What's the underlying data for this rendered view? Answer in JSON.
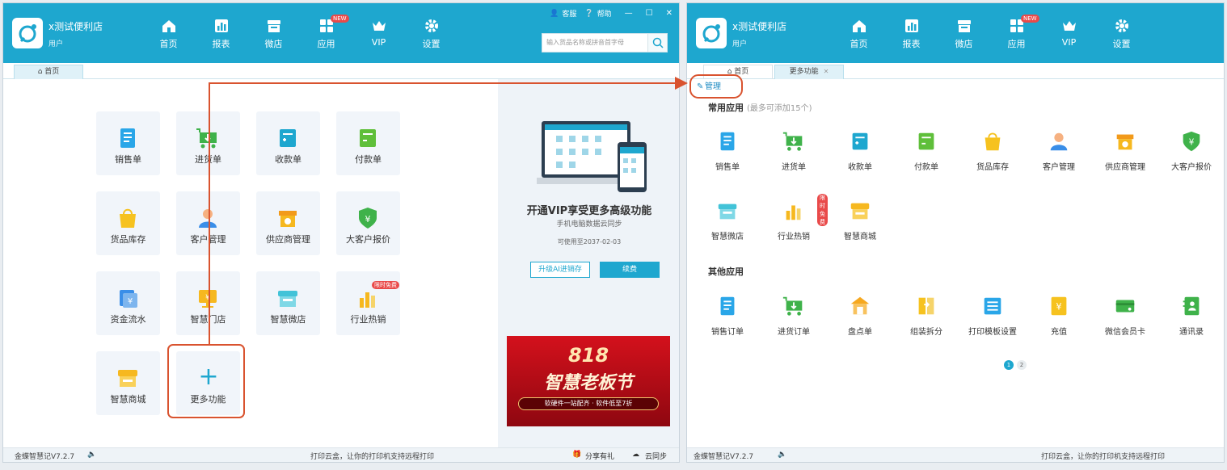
{
  "app": {
    "store_name": "x测试便利店",
    "user_role": "用户",
    "nav": [
      {
        "label": "首页",
        "icon": "home-icon"
      },
      {
        "label": "报表",
        "icon": "report-icon"
      },
      {
        "label": "微店",
        "icon": "shop-icon"
      },
      {
        "label": "应用",
        "icon": "apps-icon",
        "badge": "NEW"
      },
      {
        "label": "VIP",
        "icon": "vip-crown-icon"
      },
      {
        "label": "设置",
        "icon": "gear-icon"
      }
    ],
    "service_label": "客服",
    "help_label": "帮助",
    "search_placeholder": "输入货品名称或拼音首字母",
    "version": "金蝶智慧记V7.2.7",
    "print_promo": "打印云盒，让你的打印机支持远程打印",
    "share_label": "分享有礼",
    "sync_label": "云同步"
  },
  "left": {
    "tab_home": "首页",
    "tiles": [
      {
        "label": "销售单",
        "icon": "sales-order-icon",
        "color": "#2aa6e8"
      },
      {
        "label": "进货单",
        "icon": "purchase-cart-icon",
        "color": "#3fb24a"
      },
      {
        "label": "收款单",
        "icon": "receipt-icon",
        "color": "#1ea7cf"
      },
      {
        "label": "付款单",
        "icon": "payment-icon",
        "color": "#5fbf3a"
      },
      {
        "label": "货品库存",
        "icon": "inventory-bag-icon",
        "color": "#f6c21f"
      },
      {
        "label": "客户管理",
        "icon": "customer-icon",
        "color": "#3a8ee8"
      },
      {
        "label": "供应商管理",
        "icon": "supplier-icon",
        "color": "#f6b81f"
      },
      {
        "label": "大客户报价",
        "icon": "vip-quote-shield-icon",
        "color": "#3fb24a"
      },
      {
        "label": "资金流水",
        "icon": "cash-flow-icon",
        "color": "#3a8ee8"
      },
      {
        "label": "智慧门店",
        "icon": "smart-store-icon",
        "color": "#f6b81f"
      },
      {
        "label": "智慧微店",
        "icon": "smart-microshop-icon",
        "color": "#42c3d8"
      },
      {
        "label": "行业热销",
        "icon": "hot-sales-chart-icon",
        "color": "#f6b81f",
        "tag": "限时免费"
      },
      {
        "label": "智慧商城",
        "icon": "smart-mall-icon",
        "color": "#f6b81f"
      },
      {
        "label": "更多功能",
        "icon": "plus-icon",
        "color": "#1ea7cf"
      }
    ],
    "vip": {
      "title": "开通VIP享受更多高级功能",
      "subtitle": "手机电脑数据云同步",
      "valid_until": "可使用至2037-02-03",
      "upgrade_label": "升级AI进销存",
      "renew_label": "续费"
    },
    "banner": {
      "line1": "818",
      "line2": "智慧老板节",
      "line3": "软硬件一站配齐 · 软件低至7折"
    }
  },
  "right": {
    "tab_home": "首页",
    "tab_more": "更多功能",
    "manage_label": "管理",
    "common_title": "常用应用",
    "common_note": "(最多可添加15个)",
    "common_apps": [
      {
        "label": "销售单",
        "icon": "sales-order-icon",
        "color": "#2aa6e8"
      },
      {
        "label": "进货单",
        "icon": "purchase-cart-icon",
        "color": "#3fb24a"
      },
      {
        "label": "收款单",
        "icon": "receipt-icon",
        "color": "#1ea7cf"
      },
      {
        "label": "付款单",
        "icon": "payment-icon",
        "color": "#5fbf3a"
      },
      {
        "label": "货品库存",
        "icon": "inventory-bag-icon",
        "color": "#f6c21f"
      },
      {
        "label": "客户管理",
        "icon": "customer-icon",
        "color": "#3a8ee8"
      },
      {
        "label": "供应商管理",
        "icon": "supplier-icon",
        "color": "#f6b81f"
      },
      {
        "label": "大客户报价",
        "icon": "vip-quote-shield-icon",
        "color": "#3fb24a"
      },
      {
        "label": "智慧微店",
        "icon": "smart-microshop-icon",
        "color": "#42c3d8"
      },
      {
        "label": "行业热销",
        "icon": "hot-sales-chart-icon",
        "color": "#f6b81f",
        "tag": "限时免费"
      },
      {
        "label": "智慧商城",
        "icon": "smart-mall-icon",
        "color": "#f6b81f"
      }
    ],
    "other_title": "其他应用",
    "other_apps": [
      {
        "label": "销售订单",
        "icon": "sales-order-icon",
        "color": "#2aa6e8"
      },
      {
        "label": "进货订单",
        "icon": "purchase-cart-icon",
        "color": "#3fb24a"
      },
      {
        "label": "盘点单",
        "icon": "stocktake-icon",
        "color": "#f6a81f"
      },
      {
        "label": "组装拆分",
        "icon": "assembly-icon",
        "color": "#f6c21f"
      },
      {
        "label": "打印模板设置",
        "icon": "print-template-icon",
        "color": "#2aa6e8"
      },
      {
        "label": "充值",
        "icon": "recharge-icon",
        "color": "#f6c21f"
      },
      {
        "label": "微信会员卡",
        "icon": "member-card-icon",
        "color": "#3fb24a"
      },
      {
        "label": "通讯录",
        "icon": "contacts-icon",
        "color": "#3fb24a"
      }
    ],
    "pages": [
      "1",
      "2"
    ]
  },
  "colors": {
    "brand": "#1ea7cf",
    "highlight": "#d9532f",
    "badge": "#e94a4a"
  }
}
